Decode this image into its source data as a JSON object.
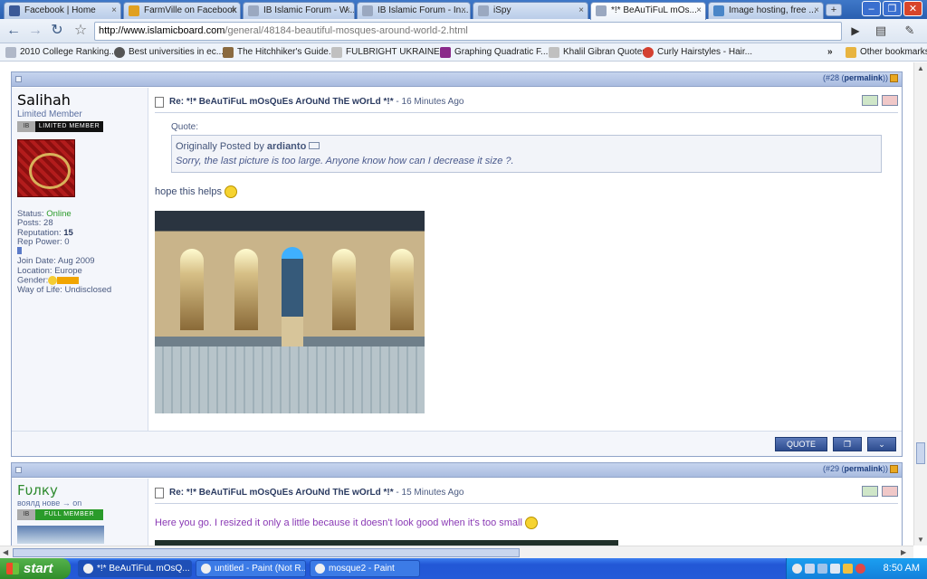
{
  "tabs": [
    {
      "title": "Facebook | Home",
      "icon": "facebook-icon",
      "color": "#3b5998"
    },
    {
      "title": "FarmVille on Facebook",
      "icon": "farmville-icon",
      "color": "#e0a020"
    },
    {
      "title": "IB Islamic Forum - W...",
      "icon": "page-icon",
      "color": "#9aa8c0"
    },
    {
      "title": "IB Islamic Forum - In...",
      "icon": "page-icon",
      "color": "#9aa8c0"
    },
    {
      "title": "iSpy",
      "icon": "page-icon",
      "color": "#9aa8c0"
    },
    {
      "title": "*!* BeAuTiFuL mOs...",
      "icon": "page-icon",
      "color": "#9aa8c0"
    },
    {
      "title": "Image hosting, free ...",
      "icon": "page-icon",
      "color": "#4a86c8"
    }
  ],
  "toolbar": {
    "url_host": "http://www.islamicboard.com",
    "url_path": "/general/48184-beautiful-mosques-around-world-2.html"
  },
  "bookmarks": [
    {
      "label": "2010 College Ranking...",
      "color": "#b0b8c8"
    },
    {
      "label": "Best universities in ec...",
      "color": "#555555"
    },
    {
      "label": "The Hitchhiker's Guide...",
      "color": "#8a6a40"
    },
    {
      "label": "FULBRIGHT UKRAINE ...",
      "color": "#c0c0c0"
    },
    {
      "label": "Graphing Quadratic F...",
      "color": "#8a2a8a"
    },
    {
      "label": "Khalil Gibran Quotes",
      "color": "#c0c0c0"
    },
    {
      "label": "Curly Hairstyles - Hair...",
      "color": "#d44030"
    }
  ],
  "other_bookmarks": "Other bookmarks",
  "post1": {
    "number": "(#28 (",
    "permalink": "permalink",
    "close_paren": "))",
    "username": "Salihah",
    "rank": "Limited Member",
    "rank_bar_left": "IB",
    "rank_bar_label": "LIMITED MEMBER",
    "rank_bar_color": "#111111",
    "status_label": "Status:",
    "status_value": "Online",
    "posts": "Posts: 28",
    "reputation_label": "Reputation:",
    "reputation_value": "15",
    "rep_power": "Rep Power: 0",
    "join_date": "Join Date: Aug 2009",
    "location": "Location: Europe",
    "gender": "Gender:",
    "way_of_life": "Way of Life: Undisclosed",
    "title_prefix": "Re: *!* BeAuTiFuL mOsQuEs ArOuNd ThE wOrLd *!*",
    "time_ago": "- 16 Minutes Ago",
    "quote_label": "Quote:",
    "quote_by": "Originally Posted by",
    "quote_author": "ardianto",
    "quote_text": "Sorry, the last picture is too large. Anyone know how can I decrease it size ?.",
    "message": "hope this helps"
  },
  "post_buttons": {
    "quote": "QUOTE"
  },
  "post2": {
    "number": "(#29 (",
    "permalink": "permalink",
    "close_paren": "))",
    "username": "Fυлку",
    "tagline": "воялд нове → on",
    "rank_bar_left": "IB",
    "rank_bar_label": "FULL MEMBER",
    "rank_bar_color": "#2a9b2a",
    "title_prefix": "Re: *!* BeAuTiFuL mOsQuEs ArOuNd ThE wOrLd *!*",
    "time_ago": "- 15 Minutes Ago",
    "message": "Here you go. I resized it only a little because it doesn't look good when it's too small"
  },
  "taskbar": {
    "start": "start",
    "tasks": [
      "*!* BeAuTiFuL mOsQ...",
      "untitled - Paint (Not R...",
      "mosque2 - Paint"
    ],
    "clock": "8:50 AM"
  }
}
